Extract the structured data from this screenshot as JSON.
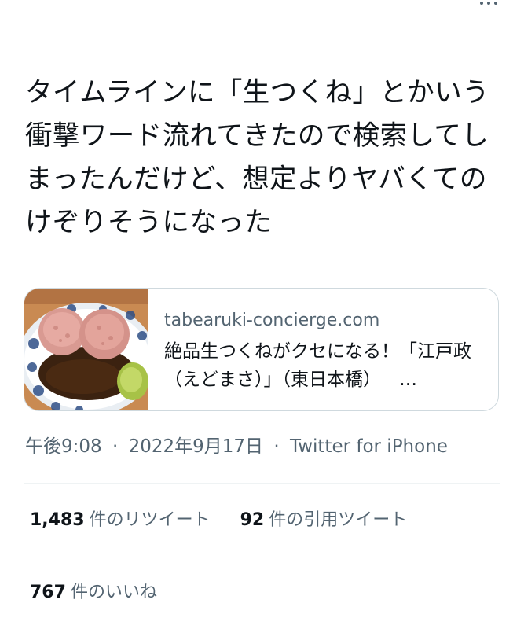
{
  "tweet": {
    "text": "タイムラインに「生つくね」とかいう衝撃ワード流れてきたので検索してしまったんだけど、想定よりヤバくてのけぞりそうになった"
  },
  "card": {
    "domain": "tabearuki-concierge.com",
    "title": "絶品生つくねがクセになる！「江戸政（えどまさ）」（東日本橋）｜…",
    "image_icon": "raw-tsukune-food-photo"
  },
  "meta": {
    "time": "午後9:08",
    "date": "2022年9月17日",
    "client": "Twitter for iPhone",
    "separator": "·"
  },
  "stats": {
    "retweets": {
      "count": "1,483",
      "label": "件のリツイート"
    },
    "quotes": {
      "count": "92",
      "label": "件の引用ツイート"
    },
    "likes": {
      "count": "767",
      "label": "件のいいね"
    }
  },
  "icons": {
    "more": "more-dots-icon"
  },
  "colors": {
    "text": "#0f1419",
    "secondary": "#536471",
    "border": "#cfd9de",
    "divider": "#eff3f4"
  }
}
